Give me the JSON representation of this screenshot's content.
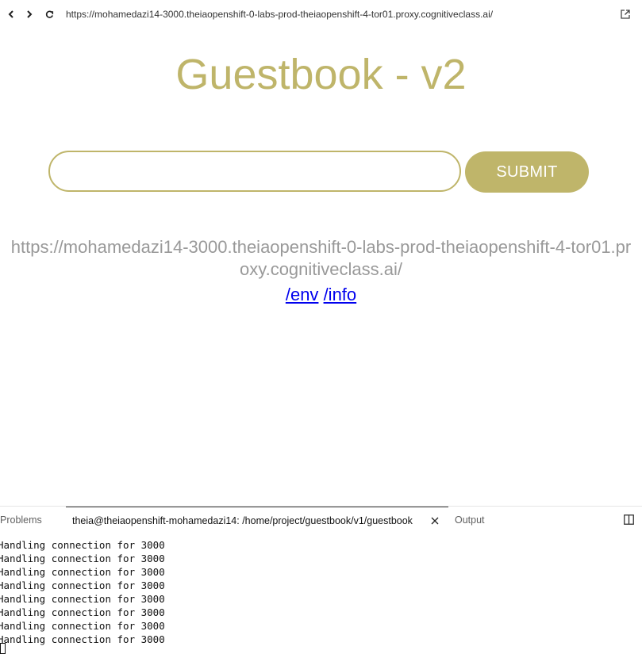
{
  "browser": {
    "url": "https://mohamedazi14-3000.theiaopenshift-0-labs-prod-theiaopenshift-4-tor01.proxy.cognitiveclass.ai/",
    "icons": [
      "back-icon",
      "forward-icon",
      "refresh-icon",
      "open-external-icon"
    ]
  },
  "guestbook": {
    "title": "Guestbook - v2",
    "input_value": "",
    "submit_label": "SUBMIT",
    "host_url": "https://mohamedazi14-3000.theiaopenshift-0-labs-prod-theiaopenshift-4-tor01.proxy.cognitiveclass.ai/",
    "link_env": "/env",
    "link_info": "/info",
    "accent_color": "#bfb56a"
  },
  "panel": {
    "tabs": [
      {
        "label": "Problems"
      },
      {
        "label": "theia@theiaopenshift-mohamedazi14: /home/project/guestbook/v1/guestbook"
      },
      {
        "label": "Output"
      }
    ],
    "terminal_lines": [
      "Handling connection for 3000",
      "Handling connection for 3000",
      "Handling connection for 3000",
      "Handling connection for 3000",
      "Handling connection for 3000",
      "Handling connection for 3000",
      "Handling connection for 3000",
      "Handling connection for 3000"
    ]
  }
}
